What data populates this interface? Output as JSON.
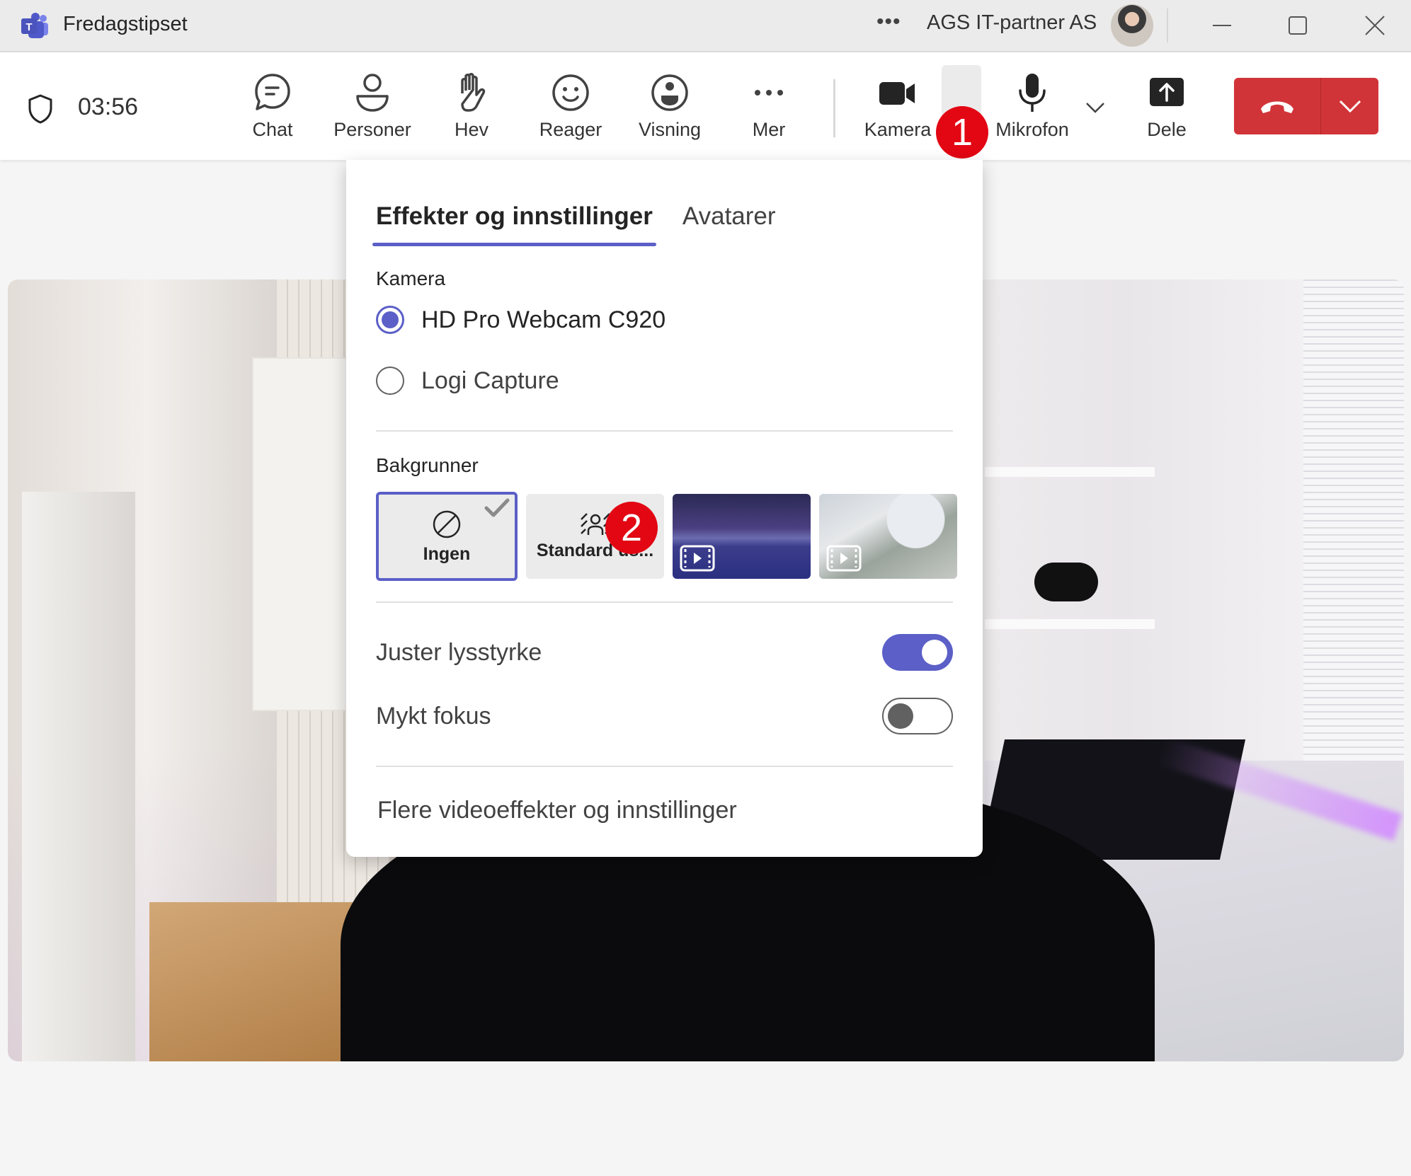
{
  "window": {
    "app_title": "Fredagstipset",
    "more_label": "•••",
    "org_name": "AGS IT-partner AS",
    "icons": {
      "logo": "teams-logo-icon",
      "minimize": "minimize-icon",
      "maximize": "maximize-icon",
      "close": "close-icon"
    }
  },
  "toolbar": {
    "timer": "03:56",
    "items": [
      {
        "label": "Chat",
        "icon": "chat-icon"
      },
      {
        "label": "Personer",
        "icon": "people-icon"
      },
      {
        "label": "Hev",
        "icon": "raise-hand-icon"
      },
      {
        "label": "Reager",
        "icon": "smiley-icon"
      },
      {
        "label": "Visning",
        "icon": "view-icon"
      },
      {
        "label": "Mer",
        "icon": "more-icon"
      },
      {
        "label": "Kamera",
        "icon": "camera-icon"
      },
      {
        "label": "Mikrofon",
        "icon": "microphone-icon"
      },
      {
        "label": "Dele",
        "icon": "share-icon"
      }
    ],
    "hangup_icon": "hang-up-icon",
    "accent_danger": "#d13438"
  },
  "annotations": {
    "badge1": "1",
    "badge2": "2",
    "badge_color": "#e30613"
  },
  "popup": {
    "tabs": [
      {
        "label": "Effekter og innstillinger",
        "active": true
      },
      {
        "label": "Avatarer",
        "active": false
      }
    ],
    "camera_section": {
      "label": "Kamera",
      "options": [
        {
          "label": "HD Pro Webcam C920",
          "selected": true
        },
        {
          "label": "Logi Capture",
          "selected": false
        }
      ]
    },
    "backgrounds_section": {
      "label": "Bakgrunner",
      "tiles": [
        {
          "label": "Ingen",
          "icon": "none-icon",
          "selected": true
        },
        {
          "label": "Standard us...",
          "icon": "background-blur-icon",
          "selected": false
        },
        {
          "label": "",
          "icon": "video-icon",
          "type": "mountain-night-video"
        },
        {
          "label": "",
          "icon": "video-icon",
          "type": "snowy-landscape-video"
        }
      ]
    },
    "toggles": [
      {
        "label": "Juster lysstyrke",
        "on": true
      },
      {
        "label": "Mykt fokus",
        "on": false
      }
    ],
    "more_link": "Flere videoeffekter og innstillinger",
    "accent": "#5b5fc7"
  }
}
